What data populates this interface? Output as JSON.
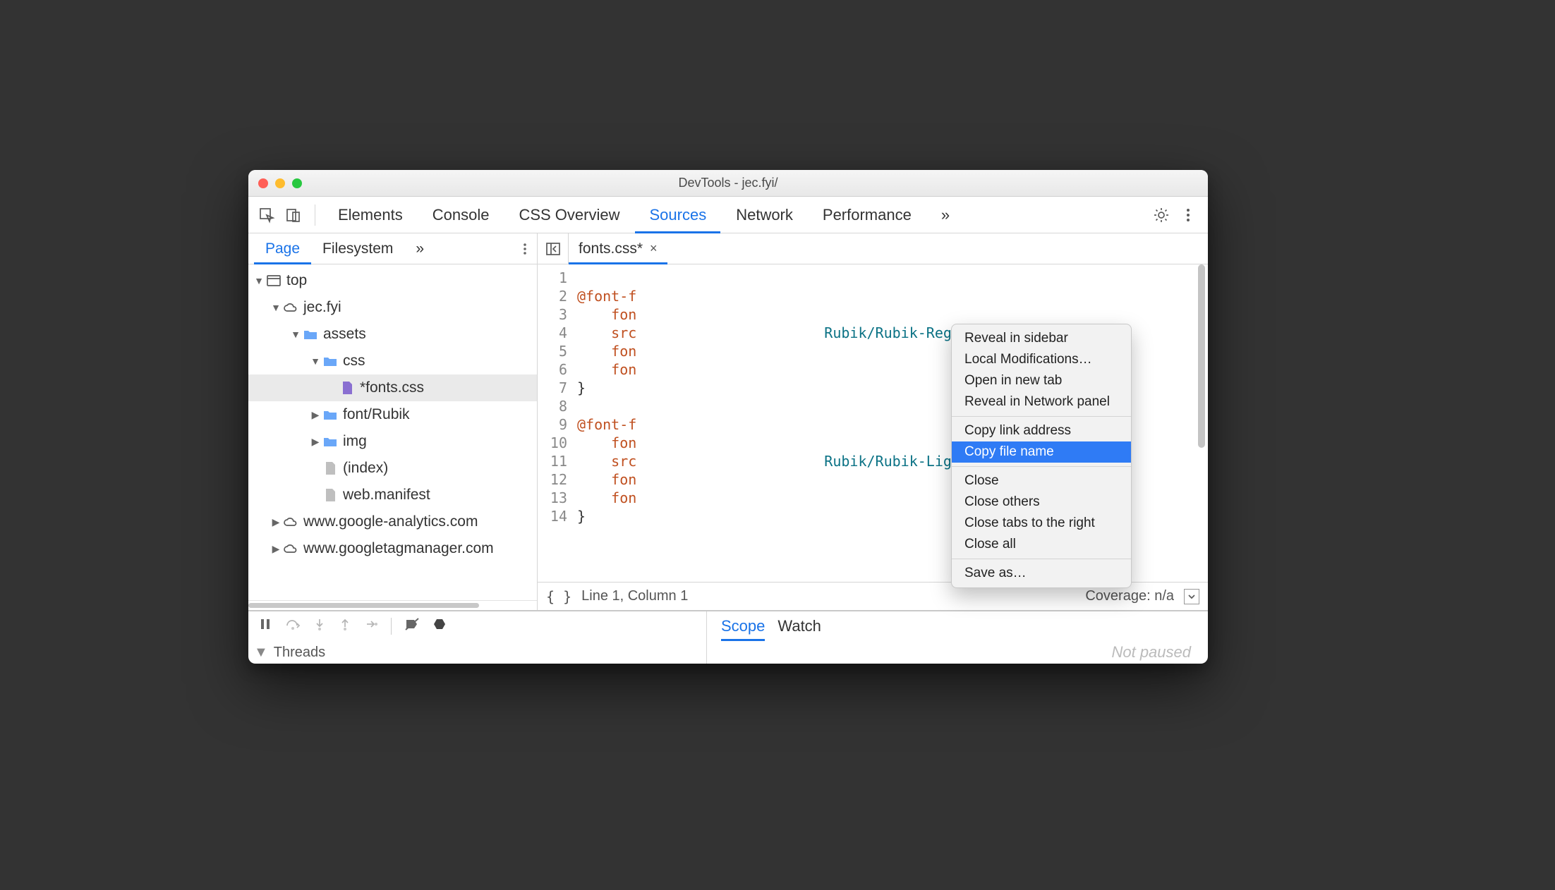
{
  "window": {
    "title": "DevTools - jec.fyi/"
  },
  "maintabs": {
    "items": [
      "Elements",
      "Console",
      "CSS Overview",
      "Sources",
      "Network",
      "Performance"
    ],
    "active": "Sources",
    "overflow": "»"
  },
  "sidebar": {
    "subtabs": {
      "items": [
        "Page",
        "Filesystem"
      ],
      "active": "Page",
      "overflow": "»"
    },
    "tree": {
      "top": "top",
      "domain": "jec.fyi",
      "assets": "assets",
      "css": "css",
      "fontscss": "*fonts.css",
      "fontrubik": "font/Rubik",
      "img": "img",
      "index": "(index)",
      "manifest": "web.manifest",
      "ga": "www.google-analytics.com",
      "gtm": "www.googletagmanager.com"
    }
  },
  "editor": {
    "tab": {
      "name": "fonts.css*",
      "close": "×"
    },
    "lines": {
      "l1": "1",
      "l2": "2",
      "l3": "3",
      "l4": "4",
      "l5": "5",
      "l6": "6",
      "l7": "7",
      "l8": "8",
      "l9": "9",
      "l10": "10",
      "l11": "11",
      "l12": "12",
      "l13": "13",
      "l14": "14"
    },
    "code": {
      "l1_a": "@font-f",
      "l2_a": "    fon",
      "l3_a": "    src",
      "l3_b": "Rubik/Rubik-Regular.ttf",
      "l3_c": ");",
      "l4_a": "    fon",
      "l5_a": "    fon",
      "l6_a": "}",
      "l8_a": "@font-f",
      "l9_a": "    fon",
      "l10_a": "    src",
      "l10_b": "Rubik/Rubik-Light.ttf",
      "l10_c": ");",
      "l11_a": "    fon",
      "l12_a": "    fon",
      "l13_a": "}"
    },
    "status": {
      "format": "{ }",
      "pos": "Line 1, Column 1",
      "coverage": "Coverage: n/a"
    }
  },
  "context_menu": {
    "items": {
      "reveal": "Reveal in sidebar",
      "localmods": "Local Modifications…",
      "opennew": "Open in new tab",
      "revealnet": "Reveal in Network panel",
      "copylink": "Copy link address",
      "copyfile": "Copy file name",
      "close": "Close",
      "closeothers": "Close others",
      "closetabsright": "Close tabs to the right",
      "closeall": "Close all",
      "saveas": "Save as…"
    },
    "highlighted": "copyfile"
  },
  "debugger": {
    "threads_label": "Threads",
    "scope_tabs": {
      "scope": "Scope",
      "watch": "Watch"
    },
    "not_paused": "Not paused"
  }
}
